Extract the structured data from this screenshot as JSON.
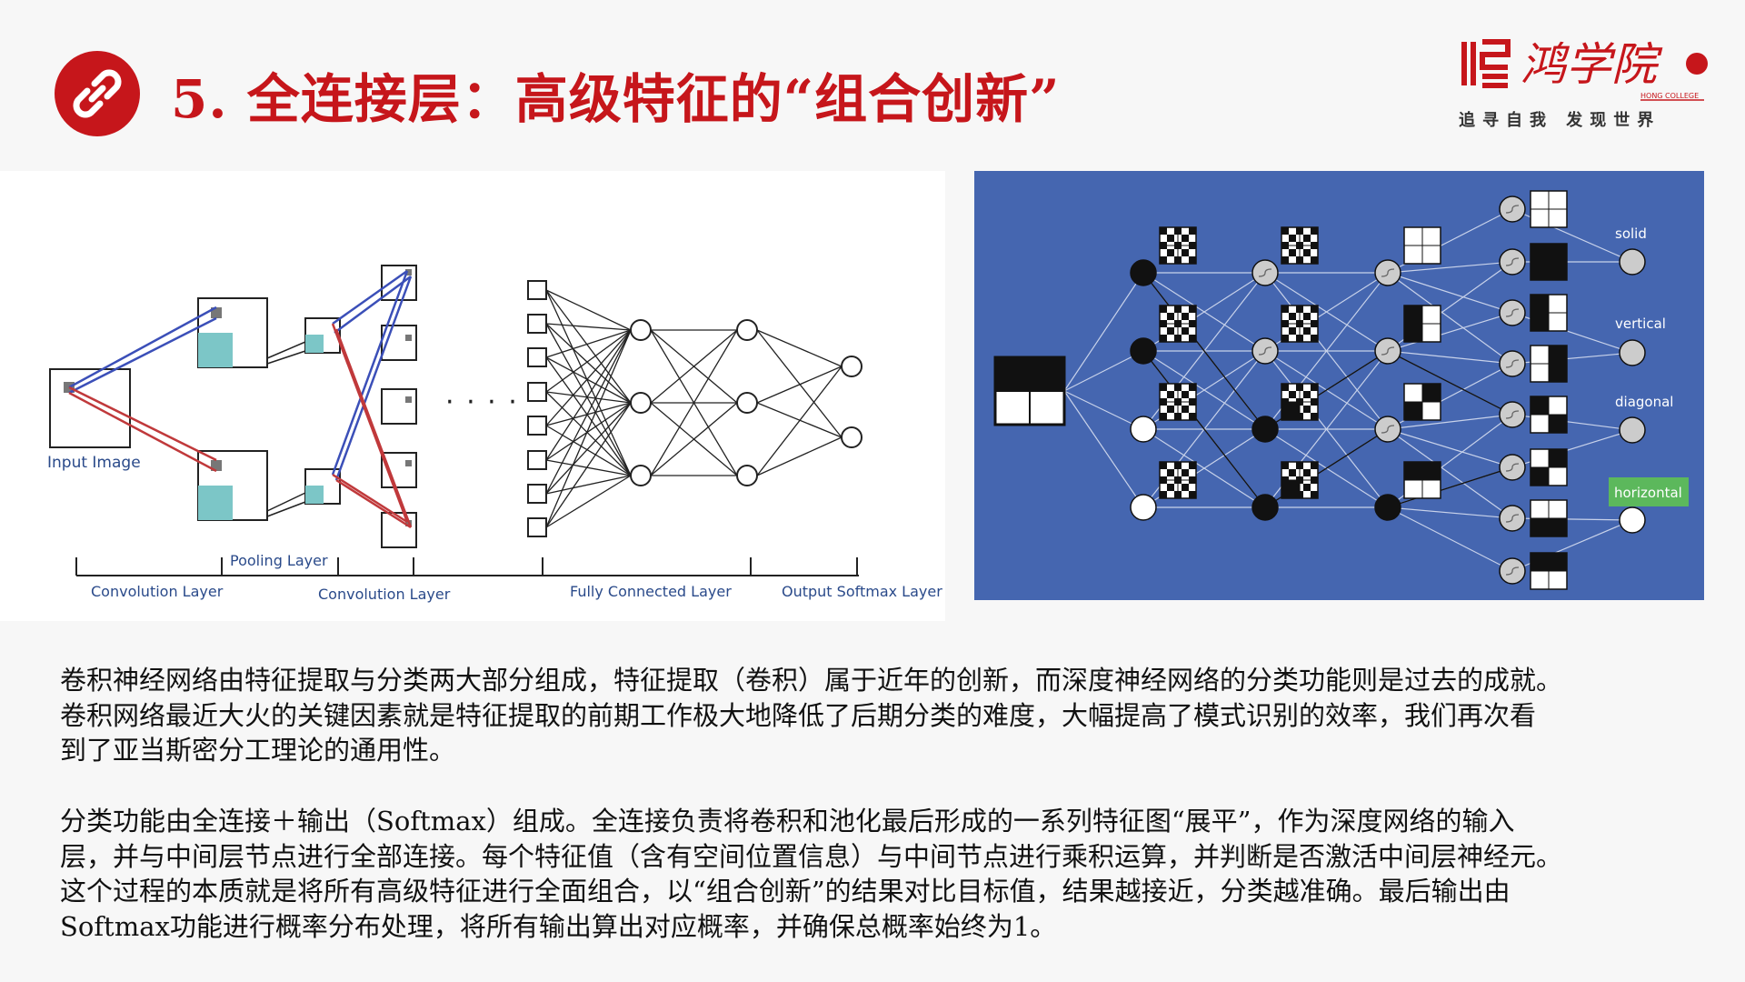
{
  "header": {
    "title": "5. 全连接层：高级特征的“组合创新”",
    "icon": "link-icon",
    "accent_color": "#c6161b"
  },
  "logo": {
    "name": "鸿学院",
    "english": "HONG COLLEGE",
    "slogan": "追寻自我  发现世界"
  },
  "cnn_diagram": {
    "input_label": "Input Image",
    "pooling_label": "Pooling Layer",
    "conv1_label": "Convolution Layer",
    "conv2_label": "Convolution Layer",
    "fc_label": "Fully Connected Layer",
    "output_label": "Output Softmax Layer",
    "ellipsis": "· · · ·"
  },
  "feature_diagram": {
    "background": "#4566b0",
    "labels": {
      "solid": "solid",
      "vertical": "vertical",
      "diagonal": "diagonal",
      "horizontal": "horizontal"
    },
    "highlight_color": "#5cb85c"
  },
  "body": {
    "p1_lines": [
      "卷积神经网络由特征提取与分类两大部分组成，特征提取（卷积）属于近年的创新，而深度神经网络的分类功能则是过去的成就。",
      "卷积网络最近大火的关键因素就是特征提取的前期工作极大地降低了后期分类的难度，大幅提高了模式识别的效率，我们再次看",
      "到了亚当斯密分工理论的通用性。"
    ],
    "p2_lines": [
      "分类功能由全连接＋输出（Softmax）组成。全连接负责将卷积和池化最后形成的一系列特征图“展平”，作为深度网络的输入",
      "层，并与中间层节点进行全部连接。每个特征值（含有空间位置信息）与中间节点进行乘积运算，并判断是否激活中间层神经元。",
      "这个过程的本质就是将所有高级特征进行全面组合，以“组合创新”的结果对比目标值，结果越接近，分类越准确。最后输出由",
      "Softmax功能进行概率分布处理，将所有输出算出对应概率，并确保总概率始终为1。"
    ]
  }
}
